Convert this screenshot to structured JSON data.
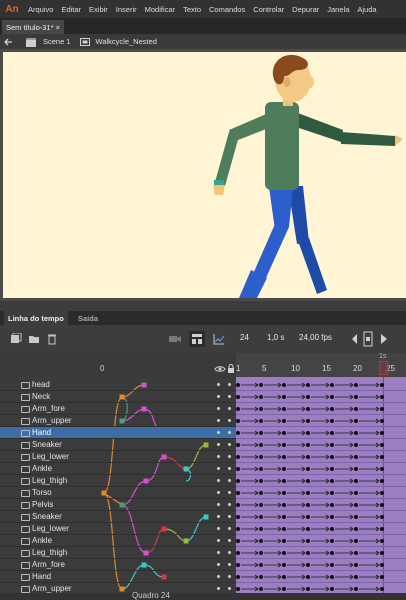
{
  "app": {
    "logo": "An",
    "menu": [
      "Arquivo",
      "Editar",
      "Exibir",
      "Inserir",
      "Modificar",
      "Texto",
      "Comandos",
      "Controlar",
      "Depurar",
      "Janela",
      "Ajuda"
    ]
  },
  "document": {
    "tab_title": "Sem título-31*",
    "close_glyph": "×"
  },
  "scenebar": {
    "scene": "Scene 1",
    "symbol": "Walkcycle_Nested"
  },
  "panel_tabs": {
    "timeline": "Linha do tempo",
    "output": "Saída"
  },
  "timeline": {
    "current_frame": "24",
    "duration": "1,0 s",
    "fps": "24,00 fps",
    "header_label": "0",
    "playhead_label": "1s",
    "ruler_ticks": [
      "1",
      "5",
      "10",
      "15",
      "20",
      "25"
    ],
    "footer": "Quadro 24",
    "layers": [
      {
        "name": "head",
        "selected": false
      },
      {
        "name": "Neck",
        "selected": false
      },
      {
        "name": "Arm_fore",
        "selected": false
      },
      {
        "name": "Arm_upper",
        "selected": false
      },
      {
        "name": "Hand",
        "selected": true
      },
      {
        "name": "Sneaker",
        "selected": false
      },
      {
        "name": "Leg_lower",
        "selected": false
      },
      {
        "name": "Ankle",
        "selected": false
      },
      {
        "name": "Leg_thigh",
        "selected": false
      },
      {
        "name": "Torso",
        "selected": false
      },
      {
        "name": "Pelvis",
        "selected": false
      },
      {
        "name": "Sneaker",
        "selected": false
      },
      {
        "name": "Leg_lower",
        "selected": false
      },
      {
        "name": "Ankle",
        "selected": false
      },
      {
        "name": "Leg_thigh",
        "selected": false
      },
      {
        "name": "Arm_fore",
        "selected": false
      },
      {
        "name": "Hand",
        "selected": false
      },
      {
        "name": "Arm_upper",
        "selected": false
      }
    ]
  },
  "colors": {
    "accent": "#e8641e",
    "frames": "#9b7fc2",
    "selection": "#3e6da6",
    "stage_bg": "#fff4d4",
    "playhead": "#d0283c"
  }
}
